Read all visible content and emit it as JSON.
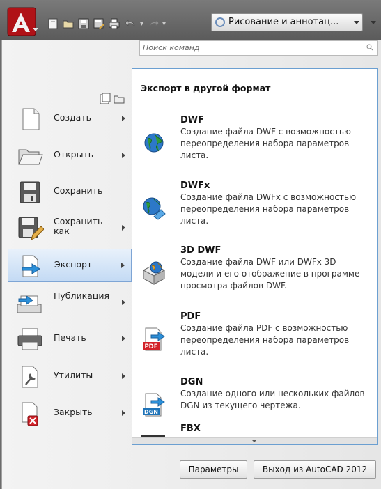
{
  "toolbar": {
    "workspace_label": "Рисование и аннотац..."
  },
  "search": {
    "placeholder": "Поиск команд"
  },
  "nav": {
    "items": [
      {
        "label": "Создать",
        "icon": "new-document-icon"
      },
      {
        "label": "Открыть",
        "icon": "open-folder-icon"
      },
      {
        "label": "Сохранить",
        "icon": "floppy-disk-icon"
      },
      {
        "label": "Сохранить как",
        "icon": "save-as-icon"
      },
      {
        "label": "Экспорт",
        "icon": "export-icon",
        "selected": true
      },
      {
        "label": "Публикация",
        "icon": "publish-icon"
      },
      {
        "label": "Печать",
        "icon": "printer-icon"
      },
      {
        "label": "Утилиты",
        "icon": "utilities-icon"
      },
      {
        "label": "Закрыть",
        "icon": "close-document-icon"
      }
    ]
  },
  "panel": {
    "title": "Экспорт в другой формат",
    "items": [
      {
        "name": "DWF",
        "desc": "Создание файла DWF с возможностью переопределения набора параметров листа.",
        "icon": "dwf-globe-icon"
      },
      {
        "name": "DWFx",
        "desc": "Создание файла DWFx с возможностью переопределения набора параметров листа.",
        "icon": "dwfx-globe-icon"
      },
      {
        "name": "3D DWF",
        "desc": "Создание файла DWF или DWFx 3D модели и его отображение в программе просмотра файлов DWF.",
        "icon": "dwf-3d-icon"
      },
      {
        "name": "PDF",
        "desc": "Создание файла PDF с возможностью переопределения набора параметров листа.",
        "icon": "pdf-icon"
      },
      {
        "name": "DGN",
        "desc": "Создание одного или нескольких файлов DGN из текущего чертежа.",
        "icon": "dgn-icon"
      },
      {
        "name": "FBX",
        "desc": "",
        "icon": "fbx-icon"
      }
    ]
  },
  "footer": {
    "options_label": "Параметры",
    "exit_label": "Выход из AutoCAD 2012"
  },
  "colors": {
    "selection": "#c3daf4",
    "panel_border": "#6b9fd1",
    "app_red": "#c4161c"
  }
}
